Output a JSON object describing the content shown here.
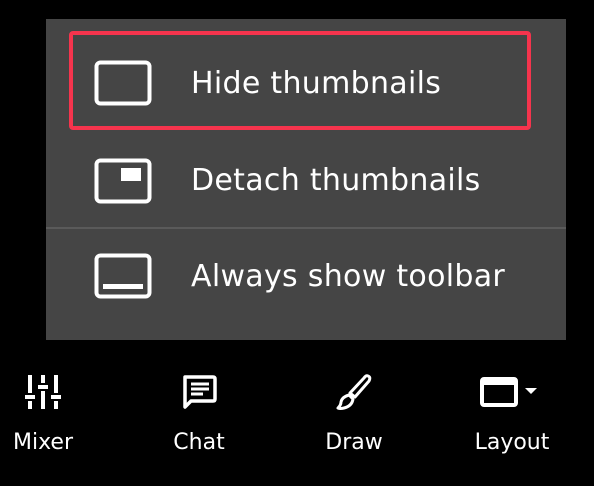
{
  "menu": {
    "items": [
      {
        "label": "Hide thumbnails",
        "icon": "hide-thumbnails-icon",
        "highlighted": true
      },
      {
        "label": "Detach thumbnails",
        "icon": "detach-thumbnails-icon",
        "highlighted": false
      },
      {
        "label": "Always show toolbar",
        "icon": "toolbar-icon",
        "highlighted": false
      }
    ]
  },
  "toolbar": {
    "items": [
      {
        "label": "Mixer",
        "icon": "mixer-sliders-icon"
      },
      {
        "label": "Chat",
        "icon": "chat-icon"
      },
      {
        "label": "Draw",
        "icon": "brush-icon"
      },
      {
        "label": "Layout",
        "icon": "layout-dropdown-icon"
      }
    ]
  },
  "colors": {
    "menu_background": "#454545",
    "highlight": "#f5344d",
    "text": "#ffffff",
    "background": "#000000"
  }
}
